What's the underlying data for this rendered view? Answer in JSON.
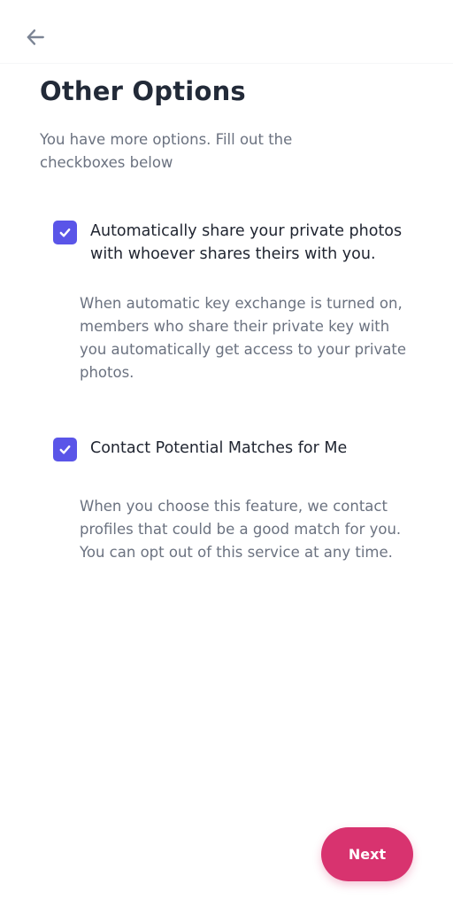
{
  "header": {
    "back_icon": "arrow-left-icon"
  },
  "main": {
    "title": "Other Options",
    "subtitle": "You have more options. Fill out the checkboxes below",
    "options": [
      {
        "checked": true,
        "label": "Automatically share your private photos with whoever shares theirs with you.",
        "description": "When automatic key exchange is turned on, members who share their private key with you automatically get access to your private photos."
      },
      {
        "checked": true,
        "label": "Contact Potential Matches for Me",
        "description": "When you choose this feature, we contact profiles that could be a good match for you. You can opt out of this service at any time."
      }
    ]
  },
  "footer": {
    "next_label": "Next"
  },
  "colors": {
    "accent": "#5a55e8",
    "primary_button": "#d8336f",
    "title": "#222a38",
    "body_text": "#6b7280"
  }
}
